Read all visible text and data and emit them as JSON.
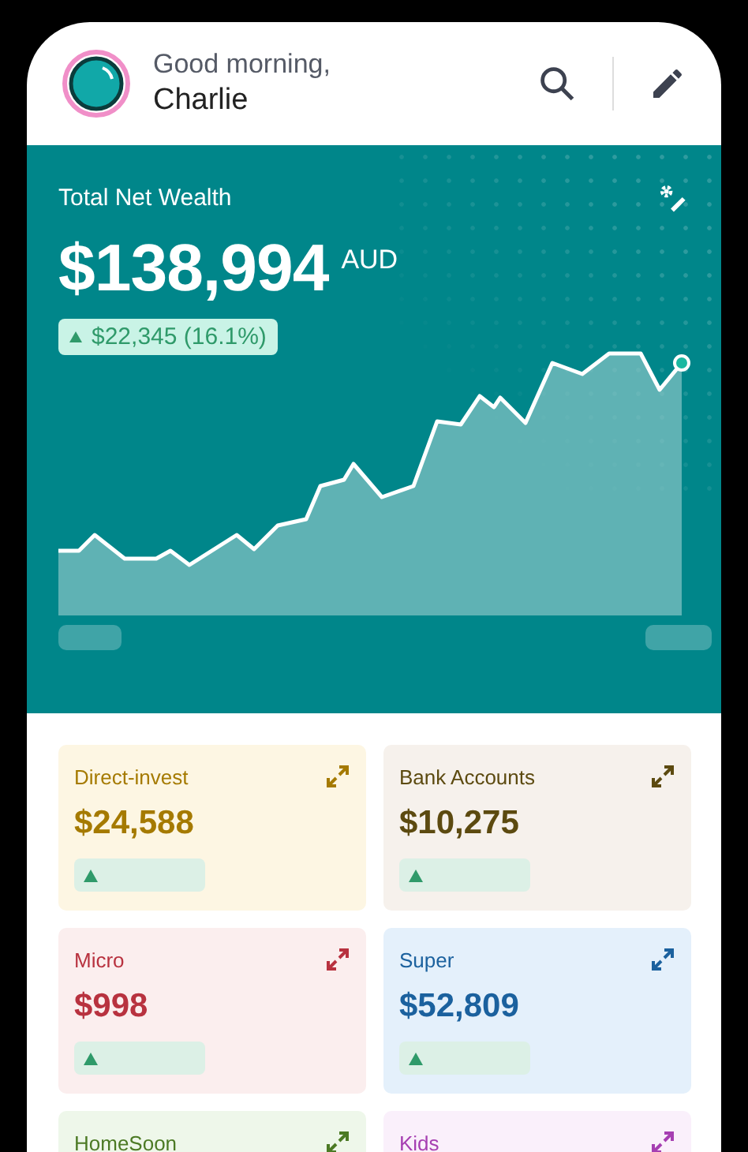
{
  "header": {
    "greeting": "Good morning,",
    "name": "Charlie"
  },
  "wealth": {
    "title": "Total Net Wealth",
    "amount": "$138,994",
    "currency": "AUD",
    "change": "$22,345 (16.1%)"
  },
  "accounts": [
    {
      "label": "Direct-invest",
      "amount": "$24,588",
      "color": "#a57a00"
    },
    {
      "label": "Bank Accounts",
      "amount": "$10,275",
      "color": "#5c4a10"
    },
    {
      "label": "Micro",
      "amount": "$998",
      "color": "#b8323f"
    },
    {
      "label": "Super",
      "amount": "$52,809",
      "color": "#1b619e"
    },
    {
      "label": "HomeSoon",
      "color": "#4c7a25"
    },
    {
      "label": "Kids",
      "color": "#a63fb2"
    }
  ]
}
